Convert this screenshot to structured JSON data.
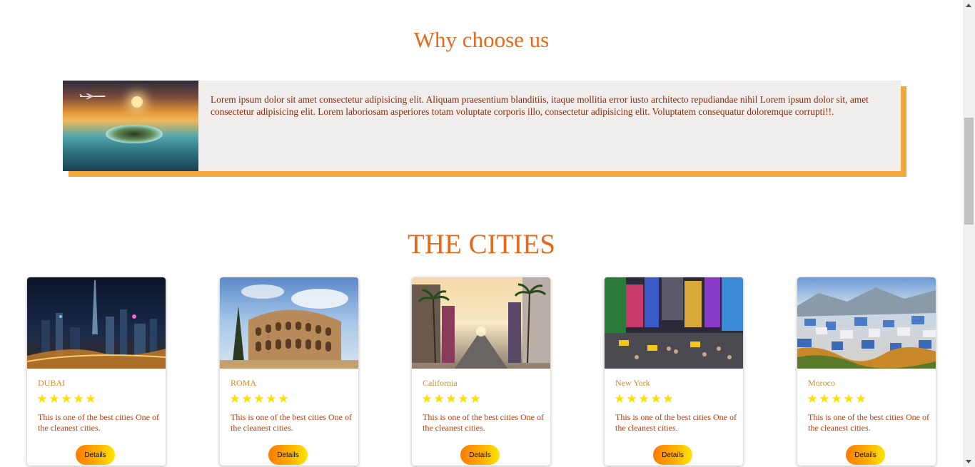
{
  "why": {
    "title": "Why choose us",
    "text": "Lorem ipsum dolor sit amet consectetur adipisicing elit. Aliquam praesentium blanditiis, itaque mollitia error iusto architecto repudiandae nihil Lorem ipsum dolor sit, amet consectetur adipisicing elit. Lorem laboriosam asperiores totam voluptate corporis illo, consectetur adipisicing elit. Voluptatem consequatur doloremque corrupti!!."
  },
  "cities": {
    "title": "THE CITIES",
    "cards": [
      {
        "name": "DUBAI",
        "rating": 5,
        "desc": "This is one of the best cities One of the cleanest cities.",
        "button": "Details"
      },
      {
        "name": "ROMA",
        "rating": 5,
        "desc": "This is one of the best cities One of the cleanest cities.",
        "button": "Details"
      },
      {
        "name": "California",
        "rating": 5,
        "desc": "This is one of the best cities One of the cleanest cities.",
        "button": "Details"
      },
      {
        "name": "New York",
        "rating": 5,
        "desc": "This is one of the best cities One of the cleanest cities.",
        "button": "Details"
      },
      {
        "name": "Moroco",
        "rating": 5,
        "desc": "This is one of the best cities One of the cleanest cities.",
        "button": "Details"
      }
    ]
  },
  "colors": {
    "accent": "#e8681a",
    "shadow": "#f4a73c",
    "star": "#ffe000"
  }
}
